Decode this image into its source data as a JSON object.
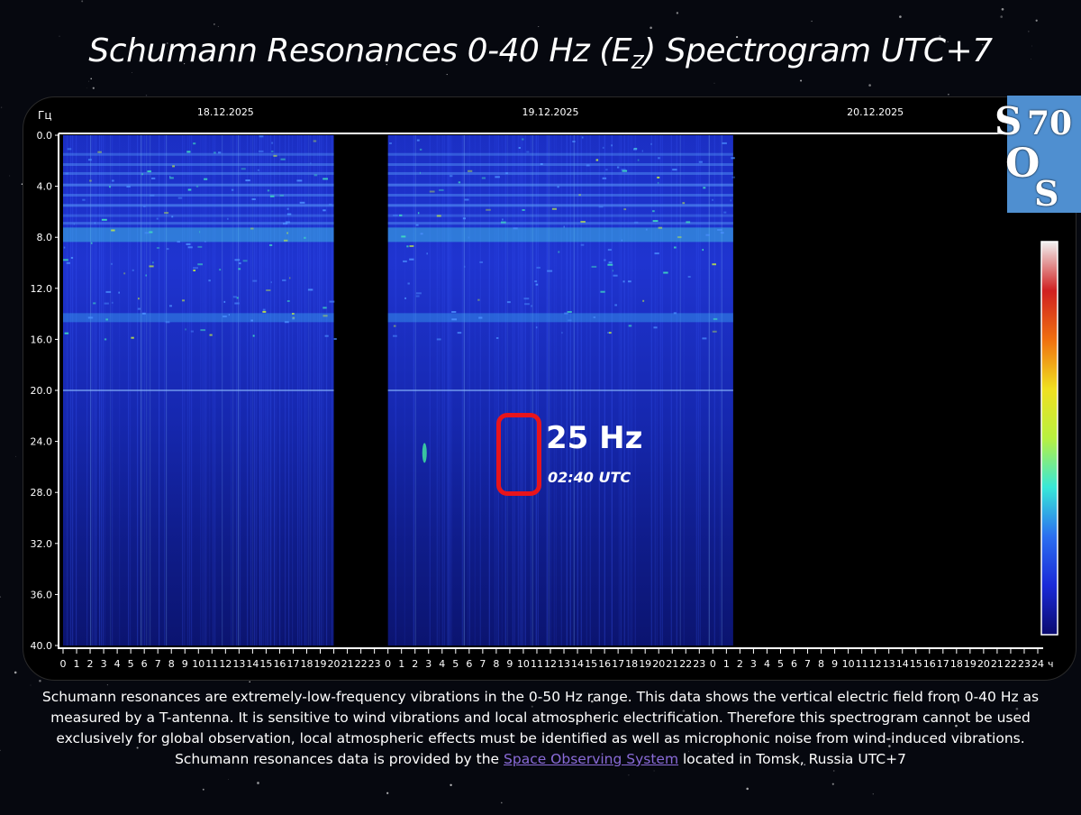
{
  "title": {
    "main": "Schumann Resonances 0-40 Hz (E",
    "sub": "Z",
    "rest": ") Spectrogram UTC+7"
  },
  "logo": {
    "s1": "S",
    "seventy": "70",
    "o": "O",
    "s2": "S"
  },
  "chart_data": {
    "type": "heatmap",
    "ylabel": "Гц",
    "y_ticks": [
      "0.0",
      "4.0",
      "8.0",
      "12.0",
      "16.0",
      "20.0",
      "24.0",
      "28.0",
      "32.0",
      "36.0",
      "40.0"
    ],
    "ylim": [
      0,
      40
    ],
    "date_labels": [
      "18.12.2025",
      "19.12.2025",
      "20.12.2025"
    ],
    "x_tick_labels": [
      "0",
      "1",
      "2",
      "3",
      "4",
      "5",
      "6",
      "7",
      "8",
      "9",
      "10",
      "11",
      "12",
      "13",
      "14",
      "15",
      "16",
      "17",
      "18",
      "19",
      "20",
      "21",
      "22",
      "23",
      "0",
      "1",
      "2",
      "3",
      "4",
      "5",
      "6",
      "7",
      "8",
      "9",
      "10",
      "11",
      "12",
      "13",
      "14",
      "15",
      "16",
      "17",
      "18",
      "19",
      "20",
      "21",
      "22",
      "23",
      "0",
      "1",
      "2",
      "3",
      "4",
      "5",
      "6",
      "7",
      "8",
      "9",
      "10",
      "11",
      "12",
      "13",
      "14",
      "15",
      "16",
      "17",
      "18",
      "19",
      "20",
      "21",
      "22",
      "23",
      "24"
    ],
    "x_unit": "ч",
    "xlim_hours": [
      0,
      72
    ],
    "data_segments_hours": [
      [
        0,
        20
      ],
      [
        24,
        49.5
      ]
    ],
    "resonance_bands_hz": [
      7.8,
      14.3,
      20.0,
      25.0
    ],
    "colors": [
      "#0a0a6e",
      "#1a2ad8",
      "#2b6ff0",
      "#38e8d8",
      "#b8f040",
      "#f0e020",
      "#f07010",
      "#d02020",
      "#f2f2f2"
    ]
  },
  "annotation": {
    "freq": "25 Hz",
    "time": "02:40 UTC"
  },
  "caption": {
    "text_before": "Schumann resonances are extremely-low-frequency vibrations in the 0-50 Hz range. This data shows the vertical electric field from 0-40 Hz as measured by a T-antenna. It is sensitive to wind vibrations and local atmospheric electrification. Therefore this spectrogram cannot be used exclusively for global observation, local atmospheric effects must be identified as well as microphonic noise from wind-induced vibrations. Schumann resonances data is provided by the ",
    "link": "Space Observing System",
    "text_after": " located in Tomsk, Russia UTC+7"
  }
}
